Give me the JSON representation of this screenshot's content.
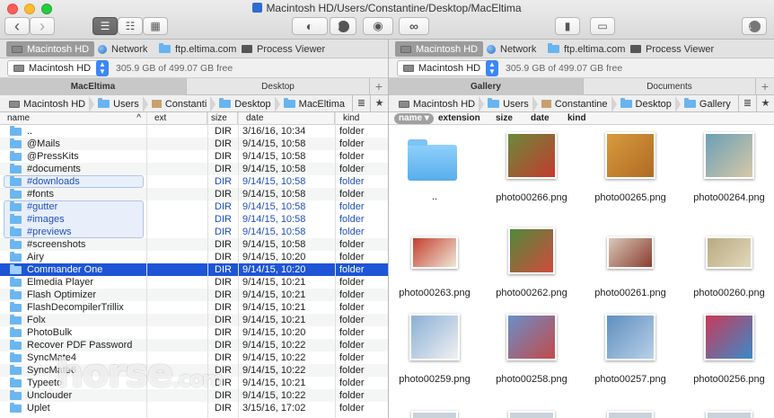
{
  "window": {
    "title": "Macintosh HD/Users/Constantine/Desktop/MacEltima"
  },
  "toolbar": {
    "back": "‹",
    "forward": "›",
    "view_list": "☰",
    "view_detail": "☷",
    "view_grid": "▦",
    "toggle": "◐",
    "info": "i",
    "eye": "◉",
    "binoculars": "∞",
    "archive": "▮",
    "network_drive": "▭",
    "download": "↓"
  },
  "drives_left": [
    {
      "label": "Macintosh HD",
      "icon": "disk-icon",
      "active": true
    },
    {
      "label": "Network",
      "icon": "globe-icon"
    },
    {
      "label": "ftp.eltima.com",
      "icon": "folder-icon"
    },
    {
      "label": "Process Viewer",
      "icon": "monitor-icon"
    }
  ],
  "drives_right": [
    {
      "label": "Macintosh HD",
      "icon": "disk-icon",
      "active": true
    },
    {
      "label": "Network",
      "icon": "globe-icon"
    },
    {
      "label": "ftp.eltima.com",
      "icon": "folder-icon"
    },
    {
      "label": "Process Viewer",
      "icon": "monitor-icon"
    }
  ],
  "volume_left": {
    "name": "Macintosh HD",
    "free": "305.9 GB of 499.07 GB free"
  },
  "volume_right": {
    "name": "Macintosh HD",
    "free": "305.9 GB of 499.07 GB free"
  },
  "tabs_left": [
    "MacEltima",
    "Desktop"
  ],
  "tabs_right": [
    "Gallery",
    "Documents"
  ],
  "plus": "+",
  "breadcrumb_left": [
    "Macintosh HD",
    "Users",
    "Constanti",
    "Desktop",
    "MacEltima"
  ],
  "breadcrumb_right": [
    "Macintosh HD",
    "Users",
    "Constantine",
    "Desktop",
    "Gallery"
  ],
  "breadcrumb_buttons": {
    "menu": "≣",
    "star": "★"
  },
  "columns_left": {
    "name": "name",
    "sort": "^",
    "ext": "ext",
    "size": "size",
    "date": "date",
    "kind": "kind"
  },
  "columns_right": {
    "name": "name ▾",
    "ext": "extension",
    "size": "size",
    "date": "date",
    "kind": "kind"
  },
  "files_left": [
    {
      "name": "..",
      "size": "DIR",
      "date": "3/16/16, 10:34",
      "kind": "folder"
    },
    {
      "name": "@Mails",
      "size": "DIR",
      "date": "9/14/15, 10:58",
      "kind": "folder"
    },
    {
      "name": "@PressKits",
      "size": "DIR",
      "date": "9/14/15, 10:58",
      "kind": "folder"
    },
    {
      "name": "#documents",
      "size": "DIR",
      "date": "9/14/15, 10:58",
      "kind": "folder"
    },
    {
      "name": "#downloads",
      "size": "DIR",
      "date": "9/14/15, 10:58",
      "kind": "folder",
      "tagged": true
    },
    {
      "name": "#fonts",
      "size": "DIR",
      "date": "9/14/15, 10:58",
      "kind": "folder"
    },
    {
      "name": "#gutter",
      "size": "DIR",
      "date": "9/14/15, 10:58",
      "kind": "folder",
      "tagged": true
    },
    {
      "name": "#images",
      "size": "DIR",
      "date": "9/14/15, 10:58",
      "kind": "folder",
      "tagged": true
    },
    {
      "name": "#previews",
      "size": "DIR",
      "date": "9/14/15, 10:58",
      "kind": "folder",
      "tagged": true
    },
    {
      "name": "#screenshots",
      "size": "DIR",
      "date": "9/14/15, 10:58",
      "kind": "folder"
    },
    {
      "name": "Airy",
      "size": "DIR",
      "date": "9/14/15, 10:20",
      "kind": "folder"
    },
    {
      "name": "Commander One",
      "size": "DIR",
      "date": "9/14/15, 10:20",
      "kind": "folder",
      "selected": true
    },
    {
      "name": "Elmedia Player",
      "size": "DIR",
      "date": "9/14/15, 10:21",
      "kind": "folder"
    },
    {
      "name": "Flash Optimizer",
      "size": "DIR",
      "date": "9/14/15, 10:21",
      "kind": "folder"
    },
    {
      "name": "FlashDecompilerTrillix",
      "size": "DIR",
      "date": "9/14/15, 10:21",
      "kind": "folder"
    },
    {
      "name": "Folx",
      "size": "DIR",
      "date": "9/14/15, 10:21",
      "kind": "folder"
    },
    {
      "name": "PhotoBulk",
      "size": "DIR",
      "date": "9/14/15, 10:20",
      "kind": "folder"
    },
    {
      "name": "Recover PDF Password",
      "size": "DIR",
      "date": "9/14/15, 10:22",
      "kind": "folder"
    },
    {
      "name": "SyncMate4",
      "size": "DIR",
      "date": "9/14/15, 10:22",
      "kind": "folder"
    },
    {
      "name": "SyncMate6",
      "size": "DIR",
      "date": "9/14/15, 10:22",
      "kind": "folder"
    },
    {
      "name": "Typeeto",
      "size": "DIR",
      "date": "9/14/15, 10:21",
      "kind": "folder"
    },
    {
      "name": "Unclouder",
      "size": "DIR",
      "date": "9/14/15, 10:22",
      "kind": "folder"
    },
    {
      "name": "Uplet",
      "size": "DIR",
      "date": "3/15/16, 17:02",
      "kind": "folder"
    }
  ],
  "gallery": [
    {
      "label": "..",
      "folder": true
    },
    {
      "label": "photo00266.png",
      "colors": [
        "#6b8a3a",
        "#c23b2e"
      ]
    },
    {
      "label": "photo00265.png",
      "colors": [
        "#d89b3e",
        "#b06a22"
      ]
    },
    {
      "label": "photo00264.png",
      "colors": [
        "#6aa0b8",
        "#d7c8a6"
      ]
    },
    {
      "label": "photo00263.png",
      "colors": [
        "#c4402e",
        "#efe7d8"
      ]
    },
    {
      "label": "photo00262.png",
      "colors": [
        "#4f8a3c",
        "#d24a3c"
      ]
    },
    {
      "label": "photo00261.png",
      "colors": [
        "#d8c9b8",
        "#8a3c2e"
      ]
    },
    {
      "label": "photo00260.png",
      "colors": [
        "#b8aa82",
        "#e2d8b8"
      ]
    },
    {
      "label": "photo00259.png",
      "colors": [
        "#8ab0d6",
        "#f0f0f0"
      ]
    },
    {
      "label": "photo00258.png",
      "colors": [
        "#6a8fc8",
        "#c24a4a"
      ]
    },
    {
      "label": "photo00257.png",
      "colors": [
        "#5f8fbf",
        "#b8d0e8"
      ]
    },
    {
      "label": "photo00256.png",
      "colors": [
        "#c83a5a",
        "#3a8ac8"
      ]
    }
  ],
  "watermark": {
    "main": "horse",
    "suffix": ".com"
  }
}
